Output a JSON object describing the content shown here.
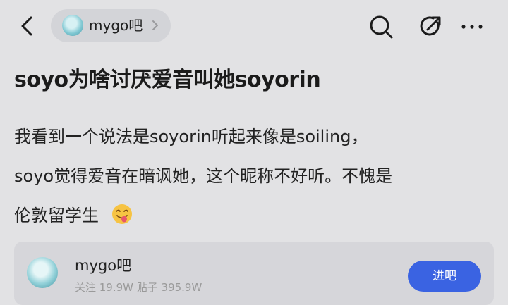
{
  "header": {
    "forum_name": "mygo吧",
    "icons": [
      "back-arrow-icon",
      "forum-avatar",
      "chevron-right-icon",
      "search-icon",
      "share-icon",
      "more-icon"
    ]
  },
  "post": {
    "title": "soyo为啥讨厌爱音叫她soyorin",
    "body_lines": [
      "我看到一个说法是soyorin听起来像是soiling，",
      "soyo觉得爱音在暗讽她，这个昵称不好听。不愧是",
      "伦敦留学生"
    ],
    "emoji": "smiling-face-with-tongue"
  },
  "forum_card": {
    "name": "mygo吧",
    "stats": "关注 19.9W   贴子 395.9W",
    "join_label": "进吧"
  },
  "colors": {
    "background": "#e2e2e4",
    "pill": "#d3d4d8",
    "accent": "#3a63e2"
  }
}
